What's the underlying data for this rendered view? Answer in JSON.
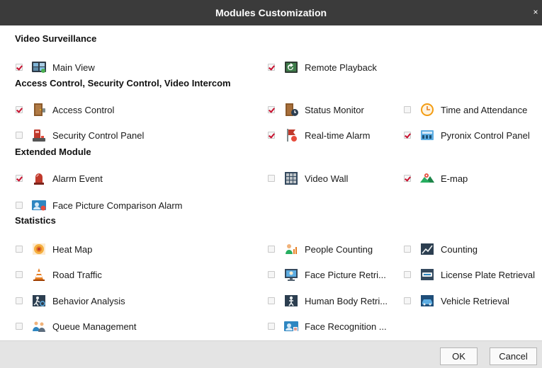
{
  "dialog": {
    "title": "Modules Customization",
    "close_glyph": "×"
  },
  "sections": {
    "video_surveillance": "Video Surveillance",
    "access_control": "Access Control, Security Control, Video Intercom",
    "extended": "Extended Module",
    "statistics": "Statistics"
  },
  "modules": {
    "main_view": {
      "label": "Main View",
      "checked": true,
      "icon": "main-view-icon"
    },
    "remote_playback": {
      "label": "Remote Playback",
      "checked": true,
      "icon": "remote-playback-icon"
    },
    "access_control": {
      "label": "Access Control",
      "checked": true,
      "icon": "access-control-door-icon"
    },
    "status_monitor": {
      "label": "Status Monitor",
      "checked": true,
      "icon": "status-monitor-icon"
    },
    "time_attendance": {
      "label": "Time and Attendance",
      "checked": false,
      "icon": "clock-icon"
    },
    "security_panel": {
      "label": "Security Control Panel",
      "checked": false,
      "icon": "security-panel-icon"
    },
    "realtime_alarm": {
      "label": "Real-time Alarm",
      "checked": true,
      "icon": "alarm-flag-icon"
    },
    "pyronix": {
      "label": "Pyronix Control Panel",
      "checked": true,
      "icon": "pyronix-panel-icon"
    },
    "alarm_event": {
      "label": "Alarm Event",
      "checked": true,
      "icon": "siren-icon"
    },
    "video_wall": {
      "label": "Video Wall",
      "checked": false,
      "icon": "video-wall-icon"
    },
    "emap": {
      "label": "E-map",
      "checked": true,
      "icon": "map-icon"
    },
    "face_comparison": {
      "label": "Face Picture Comparison Alarm",
      "checked": false,
      "icon": "face-comparison-icon"
    },
    "heat_map": {
      "label": "Heat Map",
      "checked": false,
      "icon": "heat-map-icon"
    },
    "people_counting": {
      "label": "People Counting",
      "checked": false,
      "icon": "people-counting-icon"
    },
    "counting": {
      "label": "Counting",
      "checked": false,
      "icon": "counting-icon"
    },
    "road_traffic": {
      "label": "Road Traffic",
      "checked": false,
      "icon": "traffic-cone-icon"
    },
    "face_retrieval": {
      "label": "Face Picture Retri...",
      "checked": false,
      "icon": "face-retrieval-icon"
    },
    "plate_retrieval": {
      "label": "License Plate Retrieval",
      "checked": false,
      "icon": "license-plate-icon"
    },
    "behavior": {
      "label": "Behavior Analysis",
      "checked": false,
      "icon": "behavior-analysis-icon"
    },
    "human_body": {
      "label": "Human Body Retri...",
      "checked": false,
      "icon": "human-body-icon"
    },
    "vehicle": {
      "label": "Vehicle Retrieval",
      "checked": false,
      "icon": "vehicle-icon"
    },
    "queue": {
      "label": "Queue Management",
      "checked": false,
      "icon": "queue-icon"
    },
    "face_recognition": {
      "label": "Face Recognition ...",
      "checked": false,
      "icon": "face-recognition-icon"
    }
  },
  "buttons": {
    "ok": "OK",
    "cancel": "Cancel"
  },
  "colors": {
    "titlebar": "#3b3b3b",
    "check": "#c8102e",
    "footer": "#e4e4e4"
  }
}
